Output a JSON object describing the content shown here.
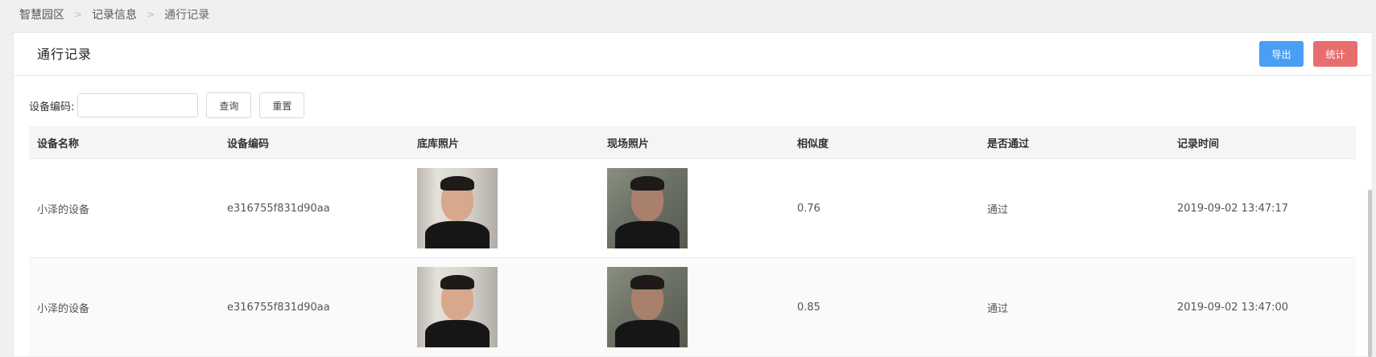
{
  "breadcrumb": [
    "智慧园区",
    "记录信息",
    "通行记录"
  ],
  "page_title": "通行记录",
  "buttons": {
    "export": "导出",
    "stats": "统计",
    "search": "查询",
    "reset": "重置"
  },
  "search": {
    "label": "设备编码:",
    "value": "",
    "placeholder": ""
  },
  "table": {
    "headers": [
      "设备名称",
      "设备编码",
      "底库照片",
      "现场照片",
      "相似度",
      "是否通过",
      "记录时间"
    ],
    "rows": [
      {
        "name": "小泽的设备",
        "code": "e316755f831d90aa",
        "similarity": "0.76",
        "passed": "通过",
        "time": "2019-09-02 13:47:17"
      },
      {
        "name": "小泽的设备",
        "code": "e316755f831d90aa",
        "similarity": "0.85",
        "passed": "通过",
        "time": "2019-09-02 13:47:00"
      }
    ]
  },
  "colors": {
    "export_btn": "#4a9ff5",
    "stats_btn": "#e86e6e"
  }
}
